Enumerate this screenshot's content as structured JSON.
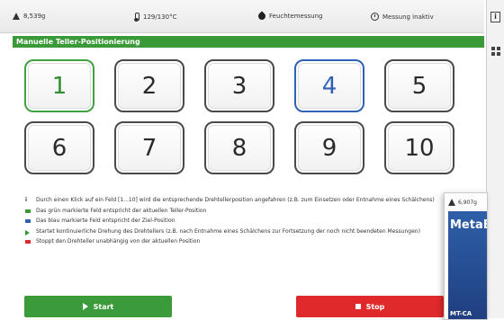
{
  "status_bar": {
    "weight": "8,539g",
    "temperature": "129/130°C",
    "moisture": "Feuchtemessung",
    "measurement": "Messung inaktiv"
  },
  "section_title": "Manuelle Teller-Positionierung",
  "positions": [
    {
      "label": "1",
      "state": "current"
    },
    {
      "label": "2",
      "state": "normal"
    },
    {
      "label": "3",
      "state": "normal"
    },
    {
      "label": "4",
      "state": "target"
    },
    {
      "label": "5",
      "state": "normal"
    },
    {
      "label": "6",
      "state": "normal"
    },
    {
      "label": "7",
      "state": "normal"
    },
    {
      "label": "8",
      "state": "normal"
    },
    {
      "label": "9",
      "state": "normal"
    },
    {
      "label": "10",
      "state": "normal"
    }
  ],
  "legend": [
    {
      "marker": "info",
      "color": "#333333",
      "text": "Durch einen Klick auf ein Feld [1...10] wird die entsprechende Drehtellerposition angefahren (z.B. zum Einsetzen oder Entnahme eines Schälchens)"
    },
    {
      "marker": "square",
      "color": "#3a9a37",
      "text": "Das grün markierte Feld entspricht der aktuellen Teller-Position"
    },
    {
      "marker": "square",
      "color": "#2f62b5",
      "text": "Das blau markierte Feld entspricht der Ziel-Position"
    },
    {
      "marker": "play",
      "color": "#2f9a33",
      "text": "Startet kontinuierliche Drehung des Drehtellers (z.B. nach Entnahme eines Schälchens zur Fortsetzung der noch nicht beendeten Messungen)"
    },
    {
      "marker": "square",
      "color": "#e0292a",
      "text": "Stoppt den Drehteller unabhängig von der aktuellen Position"
    }
  ],
  "buttons": {
    "start": "Start",
    "stop": "Stop"
  },
  "overlay_device": {
    "weight": "6,907g",
    "brand": "MetaBr",
    "model": "MT-CA"
  },
  "colors": {
    "current": "#41a243",
    "target": "#2f62b5",
    "start": "#3b9b3a",
    "stop": "#e0292a"
  }
}
